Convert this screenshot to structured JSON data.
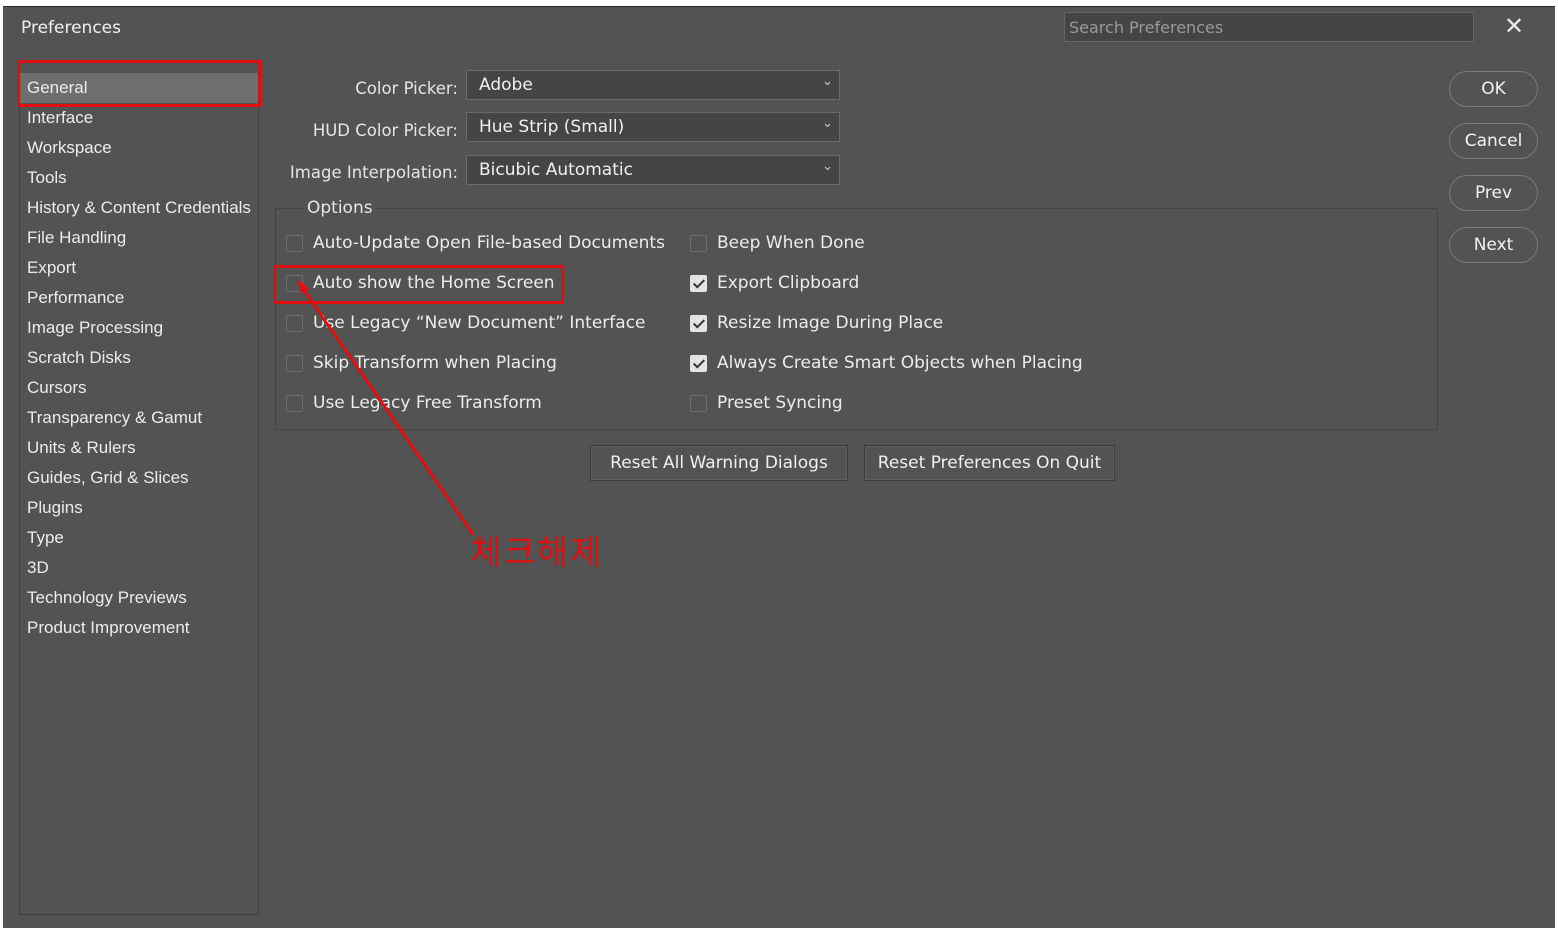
{
  "window": {
    "title": "Preferences",
    "close_symbol": "✕"
  },
  "search": {
    "placeholder": "Search Preferences"
  },
  "sidebar": {
    "items": [
      {
        "label": "General",
        "selected": true
      },
      {
        "label": "Interface"
      },
      {
        "label": "Workspace"
      },
      {
        "label": "Tools"
      },
      {
        "label": "History & Content Credentials"
      },
      {
        "label": "File Handling"
      },
      {
        "label": "Export"
      },
      {
        "label": "Performance"
      },
      {
        "label": "Image Processing"
      },
      {
        "label": "Scratch Disks"
      },
      {
        "label": "Cursors"
      },
      {
        "label": "Transparency & Gamut"
      },
      {
        "label": "Units & Rulers"
      },
      {
        "label": "Guides, Grid & Slices"
      },
      {
        "label": "Plugins"
      },
      {
        "label": "Type"
      },
      {
        "label": "3D"
      },
      {
        "label": "Technology Previews"
      },
      {
        "label": "Product Improvement"
      }
    ]
  },
  "settings": {
    "color_picker": {
      "label": "Color Picker:",
      "value": "Adobe"
    },
    "hud_color_picker": {
      "label": "HUD Color Picker:",
      "value": "Hue Strip (Small)"
    },
    "image_interpolation": {
      "label": "Image Interpolation:",
      "value": "Bicubic Automatic"
    }
  },
  "options": {
    "title": "Options",
    "left": [
      {
        "label": "Auto-Update Open File-based Documents",
        "checked": false
      },
      {
        "label": "Auto show the Home Screen",
        "checked": false
      },
      {
        "label": "Use Legacy “New Document” Interface",
        "checked": false
      },
      {
        "label": "Skip Transform when Placing",
        "checked": false
      },
      {
        "label": "Use Legacy Free Transform",
        "checked": false
      }
    ],
    "right": [
      {
        "label": "Beep When Done",
        "checked": false
      },
      {
        "label": "Export Clipboard",
        "checked": true
      },
      {
        "label": "Resize Image During Place",
        "checked": true
      },
      {
        "label": "Always Create Smart Objects when Placing",
        "checked": true
      },
      {
        "label": "Preset Syncing",
        "checked": false
      }
    ]
  },
  "actions": {
    "reset_warnings": "Reset All Warning Dialogs",
    "reset_prefs": "Reset Preferences On Quit"
  },
  "buttons": {
    "ok": "OK",
    "cancel": "Cancel",
    "prev": "Prev",
    "next": "Next"
  },
  "annotation": {
    "text": "체크해제",
    "color": "#e01010"
  },
  "colors": {
    "background": "#535353",
    "selected": "#6e6e6e",
    "annotation": "#e01010"
  }
}
